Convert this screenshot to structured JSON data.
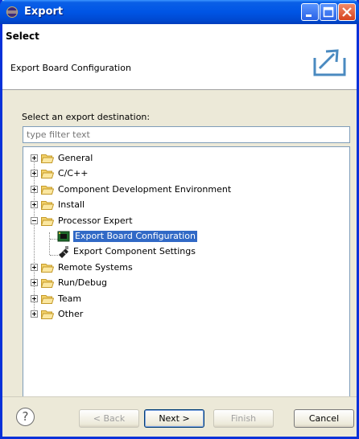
{
  "window": {
    "title": "Export"
  },
  "header": {
    "title": "Select",
    "description": "Export Board Configuration"
  },
  "main": {
    "prompt": "Select an export destination:",
    "filter_placeholder": "type filter text",
    "tree": [
      {
        "label": "General",
        "expanded": false
      },
      {
        "label": "C/C++",
        "expanded": false
      },
      {
        "label": "Component Development Environment",
        "expanded": false
      },
      {
        "label": "Install",
        "expanded": false
      },
      {
        "label": "Processor Expert",
        "expanded": true
      },
      {
        "label": "Export Board Configuration",
        "selected": true
      },
      {
        "label": "Export Component Settings"
      },
      {
        "label": "Remote Systems",
        "expanded": false
      },
      {
        "label": "Run/Debug",
        "expanded": false
      },
      {
        "label": "Team",
        "expanded": false
      },
      {
        "label": "Other",
        "expanded": false
      }
    ]
  },
  "footer": {
    "help": "?",
    "back": "< Back",
    "next": "Next >",
    "finish": "Finish",
    "cancel": "Cancel"
  },
  "colors": {
    "title_bar": "#0055e5",
    "selection": "#3169c6",
    "folder": "#f3d26b"
  }
}
